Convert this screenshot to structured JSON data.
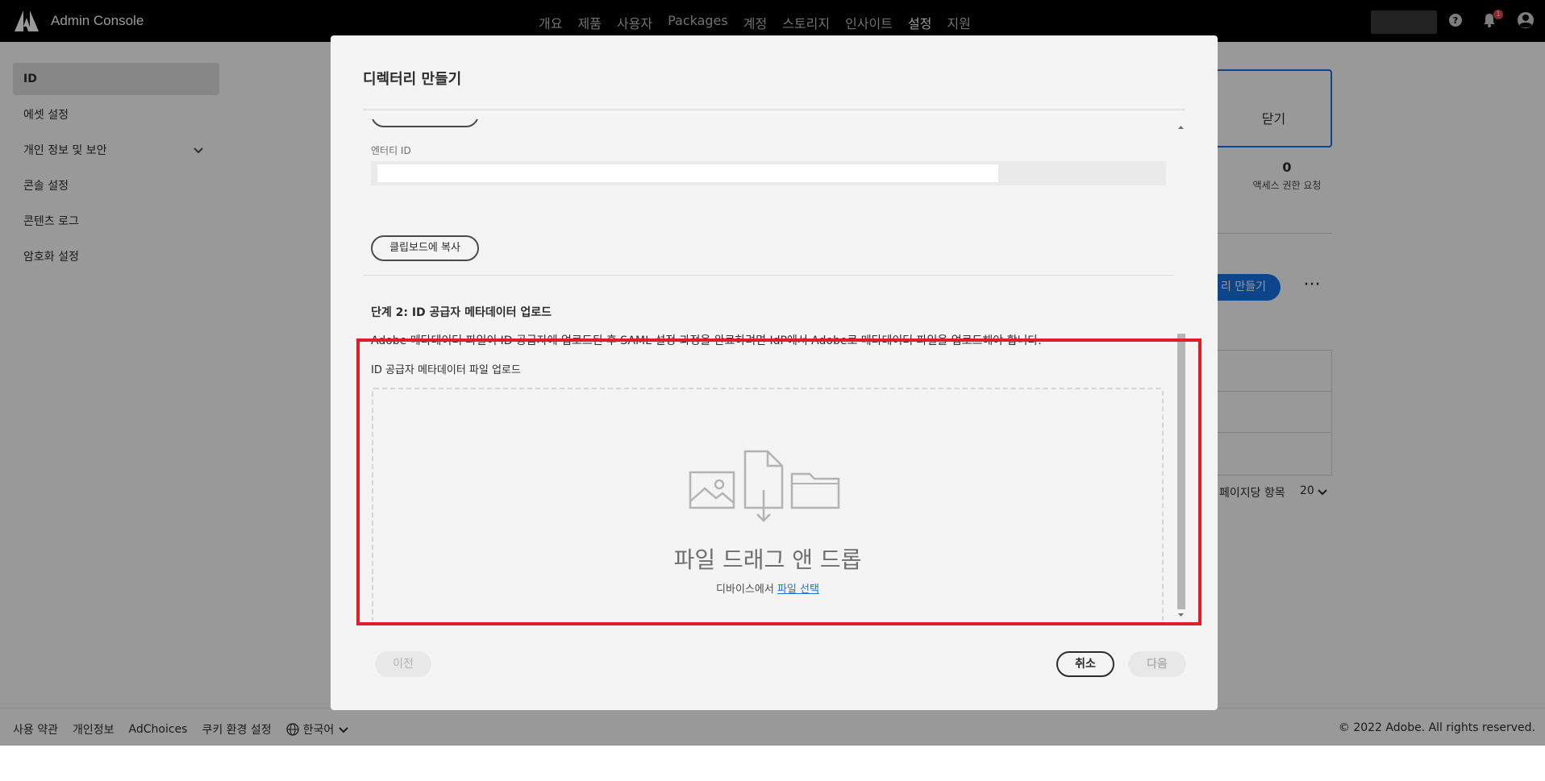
{
  "header": {
    "app_title": "Admin Console",
    "nav": [
      "개요",
      "제품",
      "사용자",
      "Packages",
      "계정",
      "스토리지",
      "인사이트",
      "설정",
      "지원"
    ],
    "active_nav": "설정",
    "notification_count": "1",
    "icons": [
      "adobe-logo-icon",
      "help-icon",
      "bell-icon",
      "user-avatar-icon"
    ]
  },
  "sidebar": {
    "items": [
      {
        "label": "ID",
        "active": true
      },
      {
        "label": "에셋 설정"
      },
      {
        "label": "개인 정보 및 보안",
        "expandable": true
      },
      {
        "label": "콘솔 설정"
      },
      {
        "label": "콘텐츠 로그"
      },
      {
        "label": "암호화 설정"
      }
    ]
  },
  "main": {
    "close_label": "닫기",
    "stat_value": "0",
    "stat_label": "액세스 권한 요청",
    "create_button": "리 만들기",
    "more_label": "···",
    "per_page_label": "페이지당 항목",
    "per_page_value": "20"
  },
  "footer": {
    "links": [
      "사용 약관",
      "개인정보",
      "AdChoices",
      "쿠키 환경 설정"
    ],
    "language": "한국어",
    "copyright": "© 2022 Adobe. All rights reserved."
  },
  "modal": {
    "title": "디렉터리 만들기",
    "entity_id_label": "엔터티 ID",
    "copy_button": "클립보드에 복사",
    "step_title": "단계 2: ID 공급자 메타데이터 업로드",
    "step_description": "Adobe 메타데이터 파일이 ID 공급자에 업로드된 후 SAML 설정 과정을 완료하려면 IdP에서 Adobe로 메타데이터 파일을 업로드해야 합니다.",
    "upload_label": "ID 공급자 메타데이터 파일 업로드",
    "dropzone_title": "파일 드래그 앤 드롭",
    "dropzone_sub_prefix": "디바이스에서",
    "dropzone_link": "파일 선택",
    "buttons": {
      "prev": "이전",
      "cancel": "취소",
      "next": "다음"
    }
  },
  "colors": {
    "accent": "#1473e6",
    "highlight": "#e01e26",
    "topbar": "#000000"
  }
}
